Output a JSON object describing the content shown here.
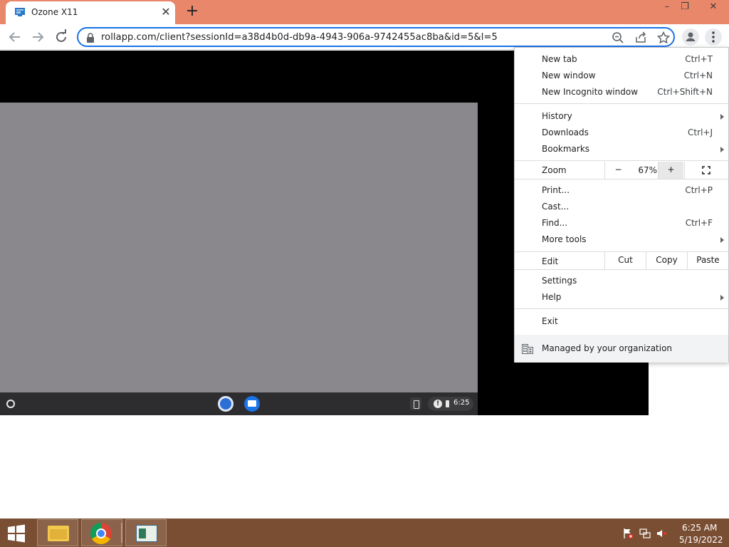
{
  "browser": {
    "tab_title": "Ozone X11",
    "url": "rollapp.com/client?sessionId=a38d4b0d-db9a-4943-906a-9742455ac8ba&id=5&l=5"
  },
  "menu": {
    "group1": [
      {
        "label": "New tab",
        "shortcut": "Ctrl+T"
      },
      {
        "label": "New window",
        "shortcut": "Ctrl+N"
      },
      {
        "label": "New Incognito window",
        "shortcut": "Ctrl+Shift+N"
      }
    ],
    "group2": [
      {
        "label": "History",
        "shortcut": ""
      },
      {
        "label": "Downloads",
        "shortcut": "Ctrl+J"
      },
      {
        "label": "Bookmarks",
        "shortcut": ""
      }
    ],
    "zoom": {
      "label": "Zoom",
      "minus": "−",
      "value": "67%",
      "plus": "+"
    },
    "group3": [
      {
        "label": "Print...",
        "shortcut": "Ctrl+P"
      },
      {
        "label": "Cast...",
        "shortcut": ""
      },
      {
        "label": "Find...",
        "shortcut": "Ctrl+F"
      },
      {
        "label": "More tools",
        "shortcut": ""
      }
    ],
    "edit": {
      "label": "Edit",
      "cut": "Cut",
      "copy": "Copy",
      "paste": "Paste"
    },
    "group4": [
      {
        "label": "Settings"
      },
      {
        "label": "Help"
      }
    ],
    "exit": "Exit",
    "managed": "Managed by your organization"
  },
  "remote": {
    "time": "6:25"
  },
  "taskbar": {
    "time": "6:25 AM",
    "date": "5/19/2022"
  },
  "colors": {
    "tabstrip": "#e8876a",
    "omnibox_border": "#1a73e8",
    "taskbar": "#7a4e32",
    "remote_desktop": "#8a888c"
  }
}
